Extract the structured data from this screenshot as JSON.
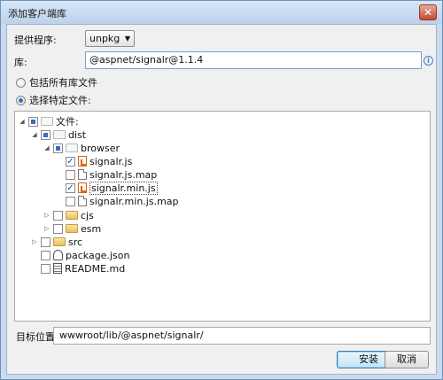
{
  "window": {
    "title": "添加客户端库",
    "close_icon": "close-icon"
  },
  "provider": {
    "label": "提供程序:",
    "value": "unpkg"
  },
  "library": {
    "label": "库:",
    "value": "@aspnet/signalr@1.1.4"
  },
  "options": {
    "include_all": "包括所有库文件",
    "choose_specific": "选择特定文件:",
    "selected": "choose_specific"
  },
  "tree": {
    "root_label": "文件:",
    "dist": "dist",
    "browser": "browser",
    "files_browser": [
      "signalr.js",
      "signalr.js.map",
      "signalr.min.js",
      "signalr.min.js.map"
    ],
    "cjs": "cjs",
    "esm": "esm",
    "src": "src",
    "package": "package.json",
    "readme": "README.md"
  },
  "target": {
    "label": "目标位置:",
    "value": "wwwroot/lib/@aspnet/signalr/"
  },
  "buttons": {
    "install": "安装",
    "cancel": "取消"
  },
  "colors": {
    "accent": "#2d6fc4",
    "title_bg": "#c9dcef"
  }
}
